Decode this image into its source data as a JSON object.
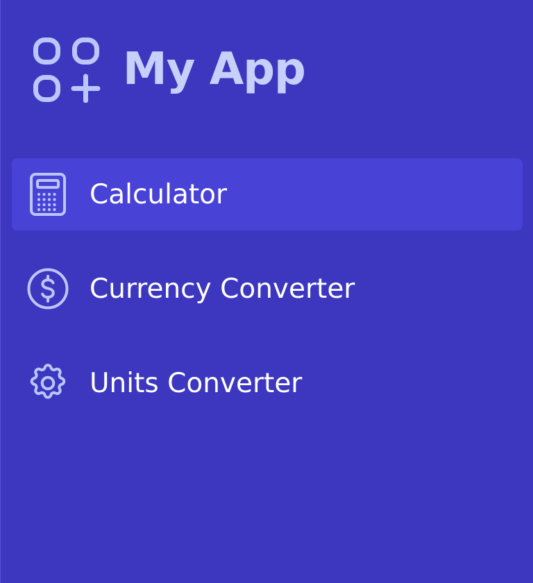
{
  "app": {
    "title": "My App",
    "logo_icon": "apps-add-icon",
    "colors": {
      "background": "#3d37c0",
      "active_item": "#4942d7",
      "brand_text": "#c7d0fb",
      "icon": "#bcc6fb",
      "label": "#ffffff"
    }
  },
  "sidebar": {
    "items": [
      {
        "label": "Calculator",
        "icon": "calculator-icon",
        "active": true
      },
      {
        "label": "Currency Converter",
        "icon": "dollar-circle-icon",
        "active": false
      },
      {
        "label": "Units Converter",
        "icon": "gear-icon",
        "active": false
      }
    ]
  }
}
